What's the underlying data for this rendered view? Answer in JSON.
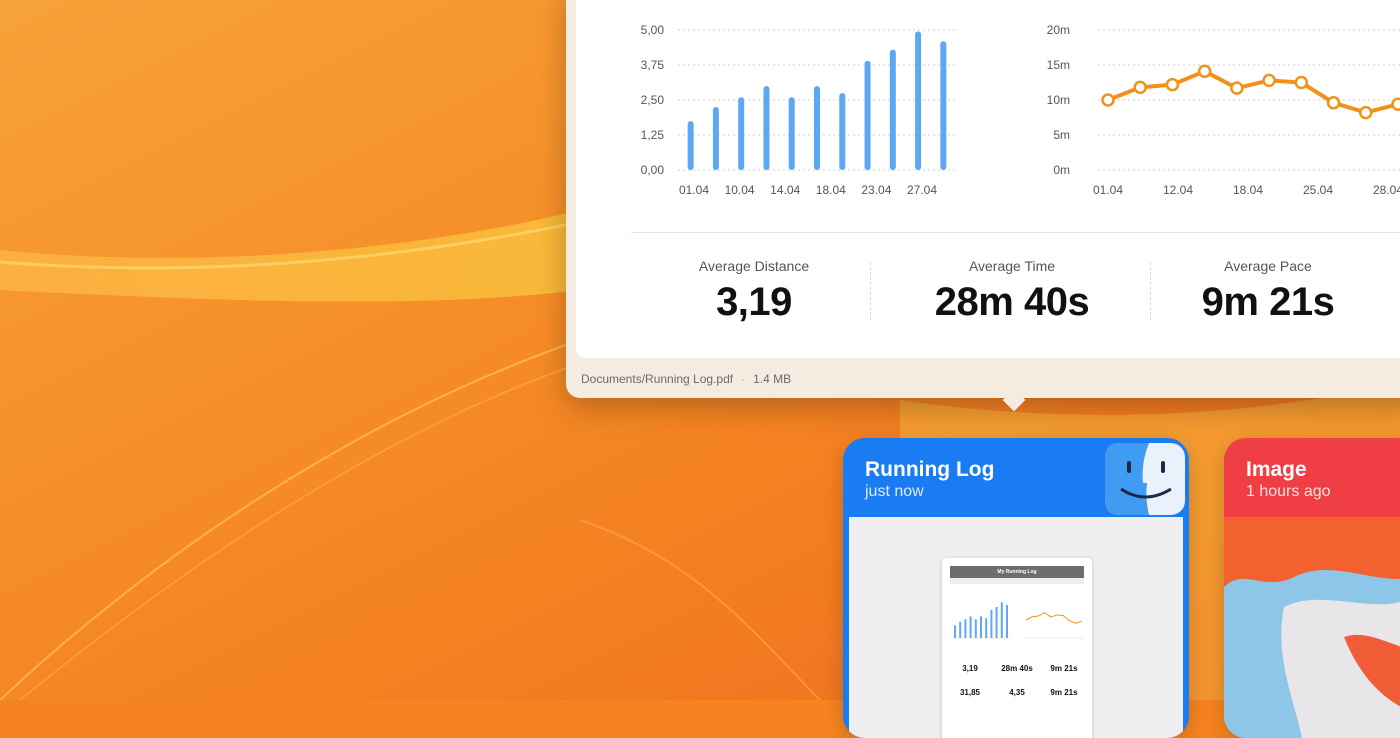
{
  "preview": {
    "distance_chart": {
      "type": "bar",
      "y_ticks": [
        "5,00",
        "3,75",
        "2,50",
        "1,25",
        "0,00"
      ],
      "x_ticks": [
        "01.04",
        "10.04",
        "14.04",
        "18.04",
        "23.04",
        "27.04"
      ],
      "values": [
        1.75,
        2.25,
        2.6,
        3.0,
        2.6,
        3.0,
        2.75,
        3.9,
        4.3,
        4.95,
        4.6
      ],
      "ylim": [
        0,
        5
      ],
      "bar_color": "#5ea8f3"
    },
    "pace_chart": {
      "type": "line",
      "y_ticks": [
        "20m",
        "15m",
        "10m",
        "5m",
        "0m"
      ],
      "x_ticks": [
        "01.04",
        "12.04",
        "18.04",
        "25.04",
        "28.04"
      ],
      "values": [
        10,
        11.8,
        12.2,
        14.1,
        11.7,
        12.8,
        12.5,
        9.6,
        8.2,
        9.4
      ],
      "ylim": [
        0,
        20
      ],
      "line_color": "#f0921a"
    },
    "stats": [
      {
        "label": "Average Distance",
        "value": "3,19"
      },
      {
        "label": "Average Time",
        "value": "28m 40s"
      },
      {
        "label": "Average Pace",
        "value": "9m 21s"
      }
    ],
    "file_path": "Documents/Running Log.pdf",
    "file_size": "1.4 MB"
  },
  "cards": {
    "running_log": {
      "title": "Running Log",
      "subtitle": "just now",
      "color": "#1a7cf2"
    },
    "image": {
      "title": "Image",
      "subtitle": "1 hours ago",
      "color": "#ef3f44"
    }
  },
  "thumbnail": {
    "heading": "My Running Log",
    "values": [
      "3,19",
      "28m 40s",
      "9m 21s",
      "31,85",
      "4,35",
      "9m 21s"
    ]
  }
}
